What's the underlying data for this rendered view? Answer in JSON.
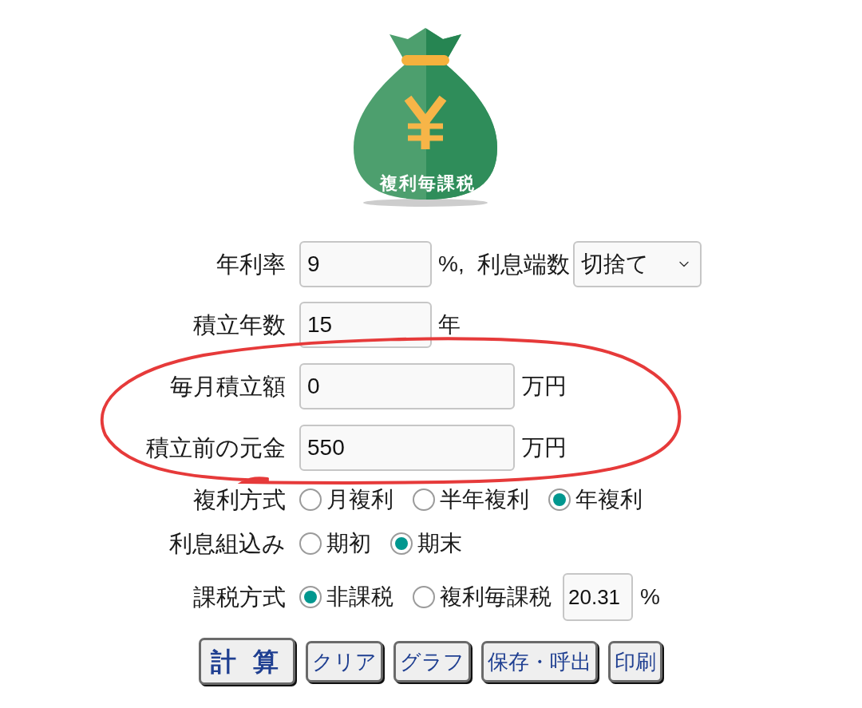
{
  "logo": {
    "caption": "複利毎課税"
  },
  "rate": {
    "label": "年利率",
    "value": "9",
    "unit": "%,"
  },
  "rounding": {
    "label": "利息端数",
    "value": "切捨て"
  },
  "years": {
    "label": "積立年数",
    "value": "15",
    "unit": "年"
  },
  "monthly": {
    "label": "毎月積立額",
    "value": "0",
    "unit": "万円"
  },
  "principal": {
    "label": "積立前の元金",
    "value": "550",
    "unit": "万円"
  },
  "compounding": {
    "label": "複利方式",
    "options": [
      {
        "label": "月複利",
        "selected": false
      },
      {
        "label": "半年複利",
        "selected": false
      },
      {
        "label": "年複利",
        "selected": true
      }
    ]
  },
  "interest_timing": {
    "label": "利息組込み",
    "options": [
      {
        "label": "期初",
        "selected": false
      },
      {
        "label": "期末",
        "selected": true
      }
    ]
  },
  "taxation": {
    "label": "課税方式",
    "options": [
      {
        "label": "非課税",
        "selected": true
      },
      {
        "label": "複利毎課税",
        "selected": false
      }
    ],
    "tax_rate": {
      "value": "20.31",
      "unit": "%"
    }
  },
  "buttons": [
    {
      "label": "計 算",
      "kind": "primary"
    },
    {
      "label": "クリア",
      "kind": "normal"
    },
    {
      "label": "グラフ",
      "kind": "normal"
    },
    {
      "label": "保存・呼出",
      "kind": "normal"
    },
    {
      "label": "印刷",
      "kind": "normal"
    }
  ]
}
